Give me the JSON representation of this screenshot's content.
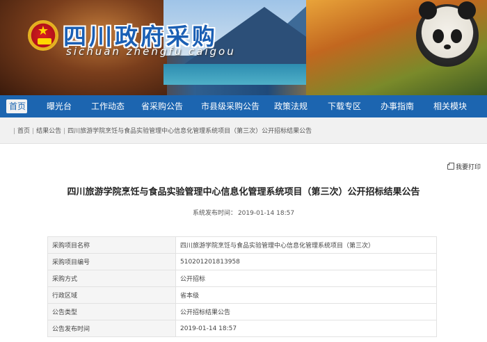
{
  "site": {
    "title": "四川政府采购",
    "subtitle": "sichuan zhengfu caigou",
    "colors": {
      "nav_bg": "#1c65b0",
      "title_blue": "#1a5fb4"
    }
  },
  "nav": {
    "items": [
      {
        "label": "首页",
        "active": true
      },
      {
        "label": "曝光台"
      },
      {
        "label": "工作动态"
      },
      {
        "label": "省采购公告"
      },
      {
        "label": "市县级采购公告"
      },
      {
        "label": "政策法规"
      },
      {
        "label": "下载专区"
      },
      {
        "label": "办事指南"
      },
      {
        "label": "相关模块"
      }
    ]
  },
  "breadcrumb": {
    "home": "首页",
    "section": "结果公告",
    "current": "四川旅游学院烹饪与食品实验管理中心信息化管理系统项目（第三次）公开招标结果公告"
  },
  "print_label": "我要打印",
  "article": {
    "title": "四川旅游学院烹饪与食品实验管理中心信息化管理系统项目（第三次）公开招标结果公告",
    "publish_label": "系统发布时间：",
    "publish_time": "2019-01-14 18:57"
  },
  "info_table": {
    "rows": [
      {
        "key": "采购项目名称",
        "value": "四川旅游学院烹饪与食品实验管理中心信息化管理系统项目（第三次）"
      },
      {
        "key": "采购项目编号",
        "value": "510201201813958"
      },
      {
        "key": "采购方式",
        "value": "公开招标"
      },
      {
        "key": "行政区域",
        "value": "省本级"
      },
      {
        "key": "公告类型",
        "value": "公开招标结果公告"
      },
      {
        "key": "公告发布时间",
        "value": "2019-01-14 18:57"
      }
    ]
  }
}
